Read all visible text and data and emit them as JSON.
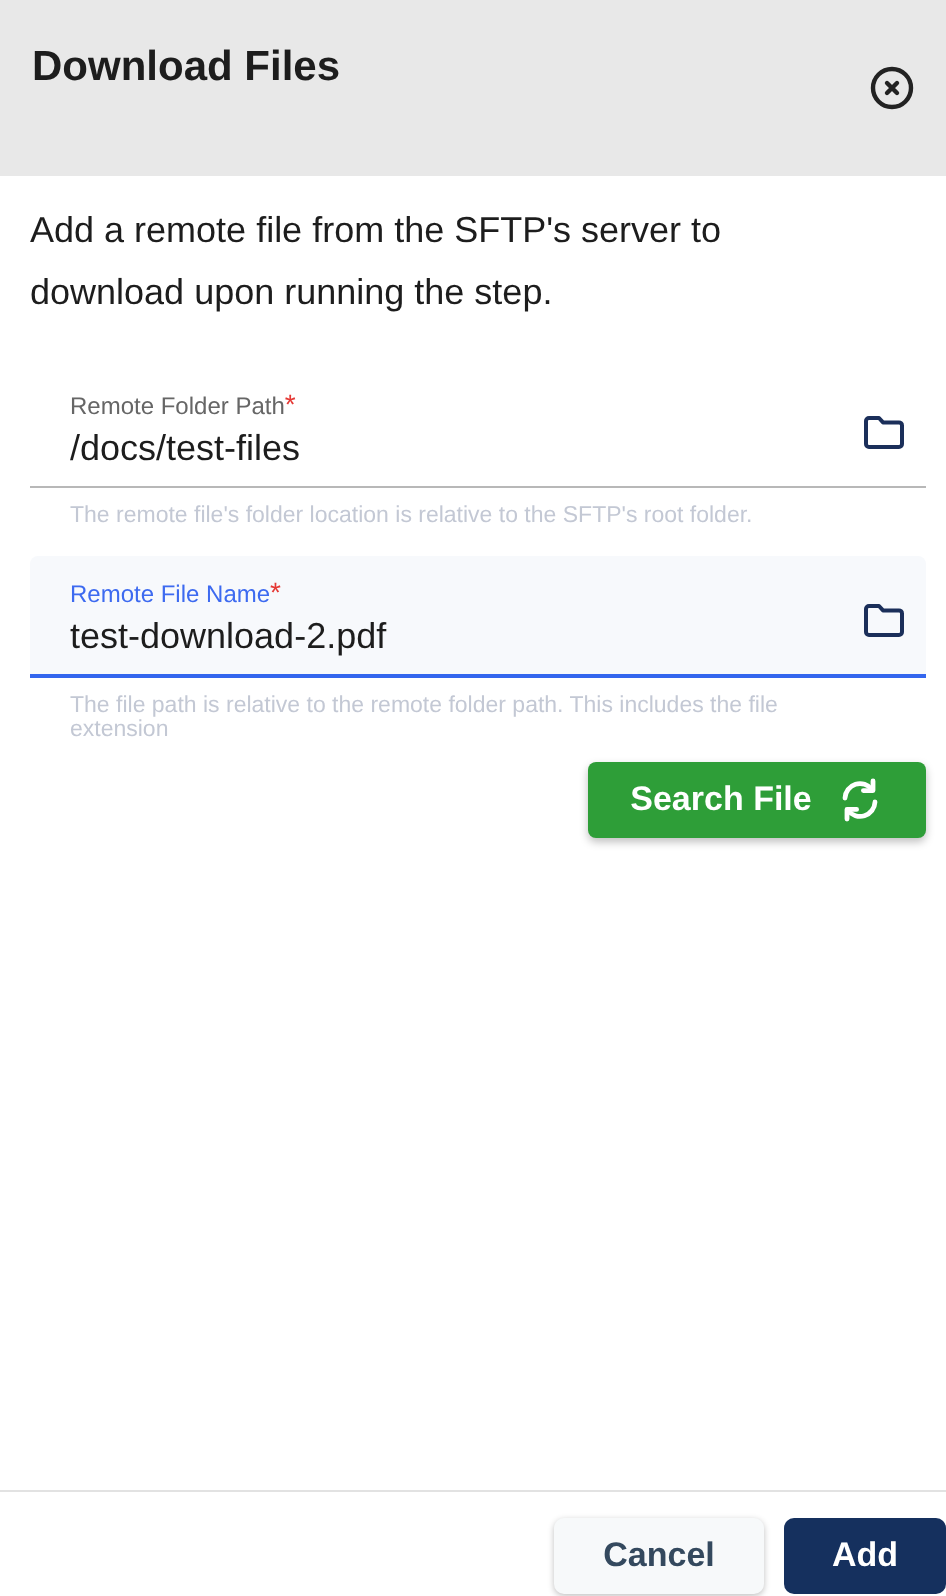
{
  "dialog": {
    "title": "Download Files",
    "description": "Add a remote file from the SFTP's server to download upon running the step."
  },
  "fields": [
    {
      "label": "Remote Folder Path",
      "required_mark": "*",
      "value": "/docs/test-files",
      "help": "The remote file's folder location is relative to the SFTP's root folder.",
      "focused": false
    },
    {
      "label": "Remote File Name",
      "required_mark": "*",
      "value": "test-download-2.pdf",
      "help": "The file path is relative to the remote folder path. This includes the file extension",
      "focused": true
    }
  ],
  "search_button": {
    "label": "Search File"
  },
  "footer": {
    "buttons": [
      {
        "label": "Cancel",
        "kind": "secondary"
      },
      {
        "label": "Add",
        "kind": "primary"
      }
    ]
  }
}
